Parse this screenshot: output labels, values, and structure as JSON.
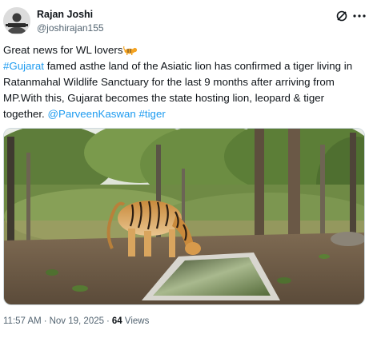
{
  "author": {
    "name": "Rajan Joshi",
    "handle": "@joshirajan155",
    "avatar": "person-avatar"
  },
  "icons": {
    "grok": "grok-icon",
    "more": "more-options-icon",
    "tiger_emoji": "tiger-emoji"
  },
  "post": {
    "line1": "Great news for WL lovers",
    "hashtag1": "#Gujarat",
    "body1": " famed asthe land of the Asiatic lion  has confirmed a tiger living in Ratanmahal Wildlife Sanctuary for the last 9 months after arriving from MP.With this, Gujarat becomes the state hosting lion, leopard & tiger together. ",
    "mention": "@ParveenKaswan",
    "hashtag2": "#tiger"
  },
  "media": {
    "description_icon": "camera-trap-photo"
  },
  "meta": {
    "time": "11:57 AM",
    "separator": "·",
    "date": "Nov 19, 2025",
    "views_count": "64",
    "views_label": "Views"
  },
  "colors": {
    "link": "#1d9bf0",
    "text": "#0f1419",
    "secondary": "#536471"
  }
}
